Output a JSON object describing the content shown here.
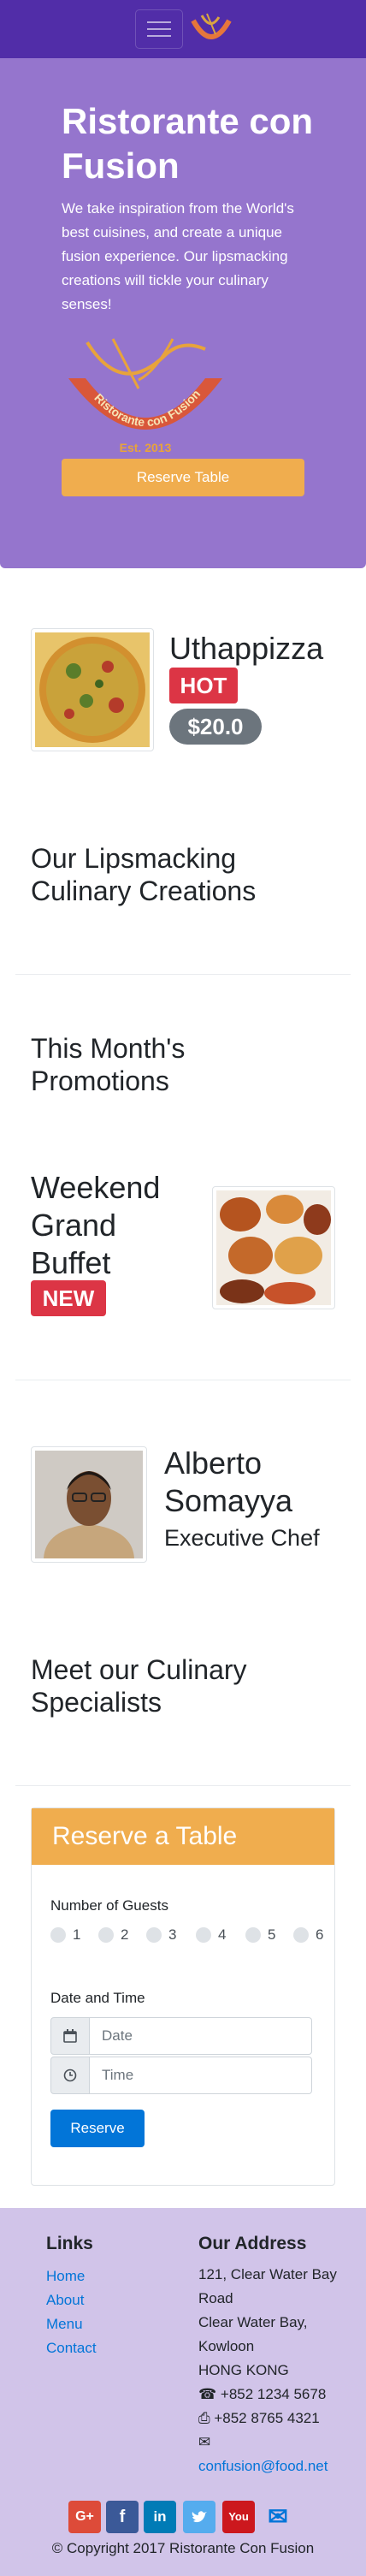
{
  "navbar": {
    "menu_icon": "hamburger-icon",
    "logo_icon": "restaurant-logo-icon"
  },
  "jumbotron": {
    "title": "Ristorante con Fusion",
    "text": "We take inspiration from the World's best cuisines, and create a unique fusion experience. Our lipsmacking creations will tickle your culinary senses!",
    "logo_text_top": "Ristorante con Fusion",
    "logo_text_bottom": "Est. 2013",
    "reserve_label": "Reserve Table"
  },
  "dish": {
    "name": "Uthappizza",
    "badge": "HOT",
    "price": "$20.0"
  },
  "creations_heading": "Our Lipsmacking Culinary Creations",
  "promotions_heading": "This Month's Promotions",
  "promotion": {
    "name": "Weekend Grand Buffet",
    "badge": "NEW"
  },
  "leader": {
    "name": "Alberto Somayya",
    "designation": "Executive Chef"
  },
  "specialists_heading": "Meet our Culinary Specialists",
  "reserve_form": {
    "title": "Reserve a Table",
    "guests_label": "Number of Guests",
    "guest_options": [
      "1",
      "2",
      "3",
      "4",
      "5",
      "6"
    ],
    "datetime_label": "Date and Time",
    "date_placeholder": "Date",
    "time_placeholder": "Time",
    "submit_label": "Reserve"
  },
  "footer": {
    "links_heading": "Links",
    "links": [
      "Home",
      "About",
      "Menu",
      "Contact"
    ],
    "address_heading": "Our Address",
    "address_lines": [
      "121, Clear Water Bay Road",
      "Clear Water Bay, Kowloon",
      "HONG KONG"
    ],
    "phone": "+852 1234 5678",
    "fax": "+852 8765 4321",
    "email": "confusion@food.net",
    "copyright": "© Copyright 2017 Ristorante Con Fusion"
  },
  "colors": {
    "primary": "#512da8",
    "jumbotron": "#9575cd",
    "footer": "#d1c4e9",
    "warning": "#f0ad4e",
    "danger": "#dc3545",
    "link": "#0275d8"
  }
}
